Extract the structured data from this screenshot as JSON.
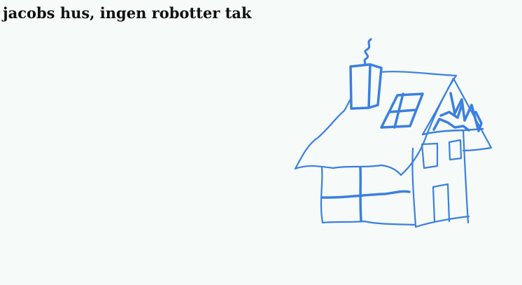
{
  "page": {
    "title": "jacobs hus, ingen robotter tak"
  },
  "colors": {
    "background": "#f6faf8",
    "ink": "#3b7fe0",
    "title": "#111111"
  },
  "drawing": {
    "subject": "house-sketch-icon"
  }
}
